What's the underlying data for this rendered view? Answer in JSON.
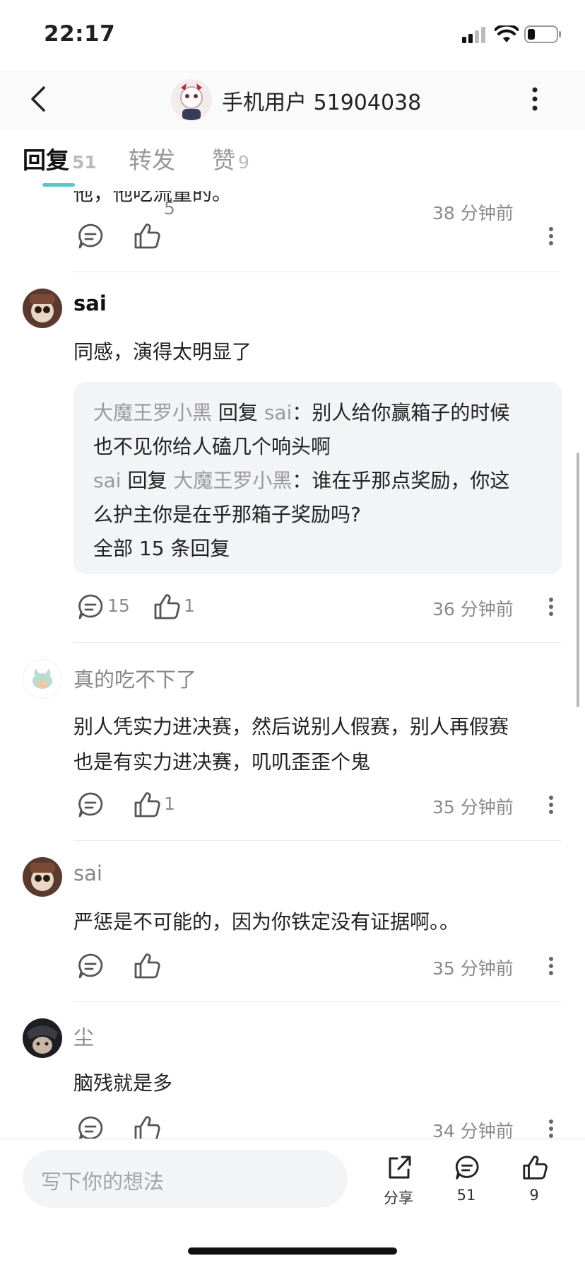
{
  "status": {
    "time": "22:17"
  },
  "header": {
    "title": "手机用户 51904038"
  },
  "tabs": [
    {
      "label": "回复",
      "count": "51"
    },
    {
      "label": "转发",
      "count": ""
    },
    {
      "label": "赞",
      "count": "9"
    }
  ],
  "comments": [
    {
      "text": "他，他吃流量的。",
      "likes": "5",
      "replies": "",
      "time": "38 分钟前"
    },
    {
      "author": "sai",
      "text": "同感，演得太明显了",
      "likes": "1",
      "replies": "15",
      "time": "36 分钟前",
      "sub_replies": {
        "r1_from": "大魔王罗小黑",
        "r1_verb": "回复",
        "r1_to": "sai",
        "r1_text_a": "：别人给你赢箱子的时候",
        "r1_text_b": "也不见你给人磕几个响头啊",
        "r2_from": "sai",
        "r2_verb": "回复",
        "r2_to": "大魔王罗小黑",
        "r2_text_a": "：谁在乎那点奖励，你这",
        "r2_text_b": "么护主你是在乎那箱子奖励吗?",
        "all_link": "全部 15 条回复"
      }
    },
    {
      "author": "真的吃不下了",
      "text_line1": "别人凭实力进决赛，然后说别人假赛，别人再假赛",
      "text_line2": "也是有实力进决赛，叽叽歪歪个鬼",
      "likes": "1",
      "time": "35 分钟前"
    },
    {
      "author": "sai",
      "text": "严惩是不可能的，因为你铁定没有证据啊。。",
      "likes": "",
      "time": "35 分钟前"
    },
    {
      "author": "尘",
      "text": "脑残就是多",
      "likes": "",
      "time": "34 分钟前"
    }
  ],
  "bottom_bar": {
    "input_placeholder": "写下你的想法",
    "share_label": "分享",
    "comment_count": "51",
    "like_count": "9"
  },
  "colors": {
    "accent": "#5ec3c6",
    "quote_bg": "#f3f4f6",
    "meta": "#8a8a8a"
  }
}
